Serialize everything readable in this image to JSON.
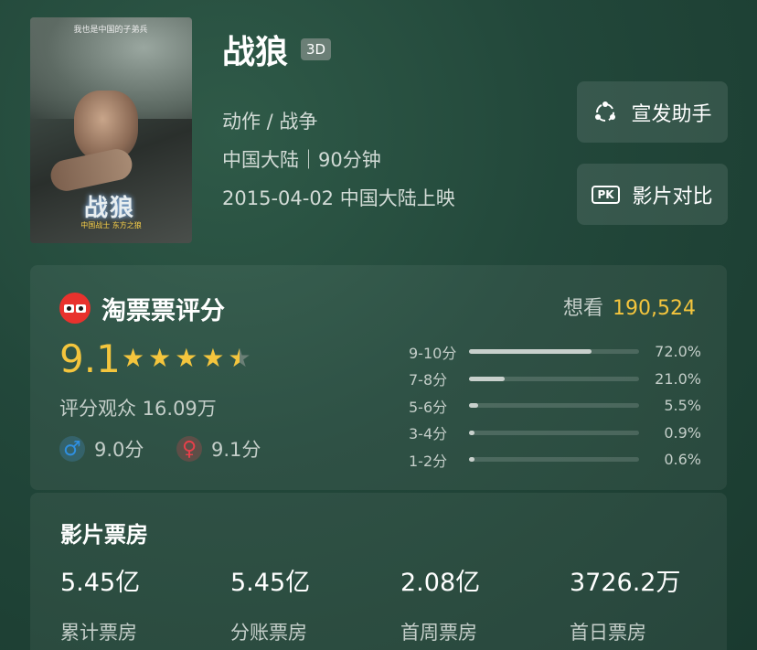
{
  "movie": {
    "title": "战狼",
    "format_badge": "3D",
    "genres": "动作 / 战争",
    "region_duration": "中国大陆｜90分钟",
    "release": "2015-04-02 中国大陆上映",
    "poster_title": "战狼",
    "poster_tagline": "中国战士 东方之狼",
    "poster_top": "我也是中国的子弟兵"
  },
  "actions": {
    "share_label": "宣发助手",
    "pk_icon": "PK",
    "pk_label": "影片对比"
  },
  "rating": {
    "source_title": "淘票票评分",
    "want_label": "想看",
    "want_count": "190,524",
    "score": "9.1",
    "stars": 4.5,
    "voters": "评分观众 16.09万",
    "male_score": "9.0分",
    "female_score": "9.1分",
    "distribution": [
      {
        "label": "9-10分",
        "percent": "72.0%",
        "value": 72.0
      },
      {
        "label": "7-8分",
        "percent": "21.0%",
        "value": 21.0
      },
      {
        "label": "5-6分",
        "percent": "5.5%",
        "value": 5.5
      },
      {
        "label": "3-4分",
        "percent": "0.9%",
        "value": 0.9
      },
      {
        "label": "1-2分",
        "percent": "0.6%",
        "value": 0.6
      }
    ]
  },
  "box_office": {
    "title": "影片票房",
    "items": [
      {
        "value": "5.45亿",
        "label": "累计票房"
      },
      {
        "value": "5.45亿",
        "label": "分账票房"
      },
      {
        "value": "2.08亿",
        "label": "首周票房"
      },
      {
        "value": "3726.2万",
        "label": "首日票房"
      }
    ]
  },
  "colors": {
    "accent_yellow": "#f4c53d",
    "male_blue": "#2f8fe0",
    "female_red": "#e8404a",
    "logo_red": "#e8322d"
  }
}
